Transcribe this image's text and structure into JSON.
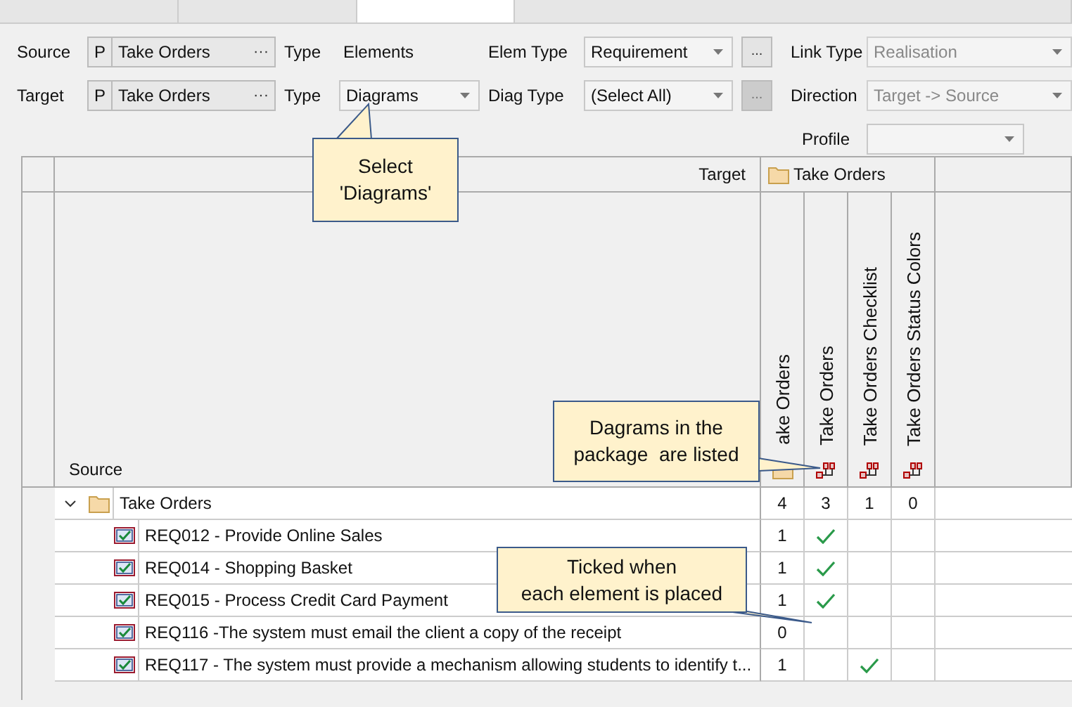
{
  "tabs": [
    {
      "selected": false
    },
    {
      "selected": false
    },
    {
      "selected": true
    },
    {
      "selected": false
    }
  ],
  "filters": [
    {
      "label": "Source",
      "scope": "P",
      "value": "Take Orders",
      "browse": "···",
      "type_label": "Type",
      "type_editable": false,
      "type_value": "Elements",
      "filter_label": "Elem Type",
      "filter_value": "Requirement",
      "filter_button": "...",
      "filter_button_disabled": false,
      "option_label": "Link Type",
      "option_value": "Realisation",
      "option_disabled": true
    },
    {
      "label": "Target",
      "scope": "P",
      "value": "Take Orders",
      "browse": "···",
      "type_label": "Type",
      "type_editable": true,
      "type_value": "Diagrams",
      "filter_label": "Diag Type",
      "filter_value": "(Select All)",
      "filter_button": "...",
      "filter_button_disabled": true,
      "option_label": "Direction",
      "option_value": "Target -> Source",
      "option_disabled": true
    }
  ],
  "profile": {
    "label": "Profile"
  },
  "matrix": {
    "target_label": "Target",
    "target_package": "Take Orders",
    "source_label": "Source",
    "columns": [
      {
        "name": "ake Orders",
        "kind": "package"
      },
      {
        "name": "Take Orders",
        "kind": "diagram"
      },
      {
        "name": "Take Orders Checklist",
        "kind": "diagram"
      },
      {
        "name": "Take Orders Status Colors",
        "kind": "diagram"
      }
    ],
    "rows": [
      {
        "name": "Take Orders",
        "kind": "package",
        "expanded": true,
        "cells": [
          {
            "text": "4"
          },
          {
            "text": "3"
          },
          {
            "text": "1"
          },
          {
            "text": "0"
          }
        ]
      },
      {
        "name": "REQ012 - Provide Online Sales",
        "kind": "requirement",
        "cells": [
          {
            "text": "1"
          },
          {
            "checked": true
          },
          {
            "checked": false
          },
          {
            "checked": false
          }
        ]
      },
      {
        "name": "REQ014 - Shopping Basket",
        "kind": "requirement",
        "cells": [
          {
            "text": "1"
          },
          {
            "checked": true
          },
          {
            "checked": false
          },
          {
            "checked": false
          }
        ]
      },
      {
        "name": "REQ015 - Process Credit Card Payment",
        "kind": "requirement",
        "cells": [
          {
            "text": "1"
          },
          {
            "checked": true
          },
          {
            "checked": false
          },
          {
            "checked": false
          }
        ]
      },
      {
        "name": "REQ116 -The system must email the client a copy of the receipt",
        "kind": "requirement",
        "cells": [
          {
            "text": "0"
          },
          {
            "checked": false
          },
          {
            "checked": false
          },
          {
            "checked": false
          }
        ]
      },
      {
        "name": "REQ117 - The system must provide a mechanism allowing students to identify t...",
        "kind": "requirement",
        "cells": [
          {
            "text": "1"
          },
          {
            "checked": false
          },
          {
            "checked": true
          },
          {
            "checked": false
          }
        ]
      }
    ]
  },
  "callouts": [
    {
      "text": "Select\n'Diagrams'"
    },
    {
      "text": "Dagrams in the\npackage  are listed"
    },
    {
      "text": "Ticked when\neach element is placed"
    }
  ]
}
